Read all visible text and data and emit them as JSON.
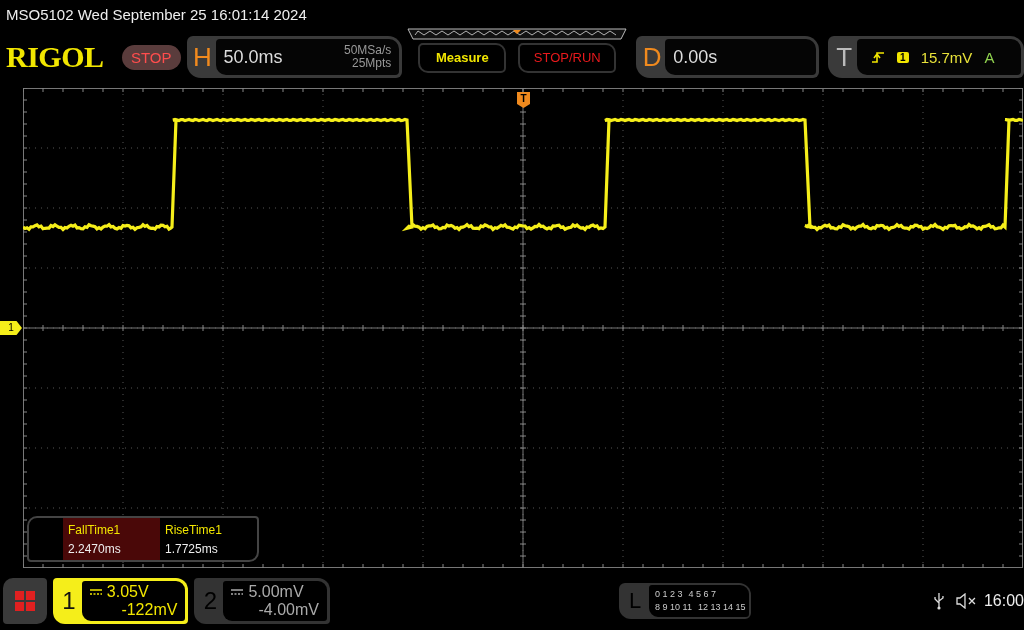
{
  "status_line": "MSO5102  Wed September 25 16:01:14 2024",
  "logo": "RIGOL",
  "run_state": "STOP",
  "horizontal": {
    "label": "H",
    "scale": "50.0ms",
    "sample_rate": "50MSa/s",
    "memory_depth": "25Mpts"
  },
  "buttons": [
    {
      "label": "Measure",
      "kind": "menu"
    },
    {
      "label": "STOP/RUN",
      "kind": "run"
    }
  ],
  "delay": {
    "label": "D",
    "value": "0.00s"
  },
  "trigger": {
    "label": "T",
    "source": "1",
    "level": "15.7mV",
    "mode": "A"
  },
  "trigger_marker": "T",
  "channel_marker": "1",
  "measurements": [
    {
      "name": "FallTime1",
      "value": "2.2470ms",
      "selected": true
    },
    {
      "name": "RiseTime1",
      "value": "1.7725ms",
      "selected": false
    }
  ],
  "channels": [
    {
      "number": "1",
      "scale": "3.05V",
      "offset": "-122mV",
      "selected": true
    },
    {
      "number": "2",
      "scale": "5.00mV",
      "offset": "-4.00mV",
      "selected": false
    }
  ],
  "logic": {
    "label": "L",
    "rows": [
      [
        "0 1 2 3",
        "4 5 6 7"
      ],
      [
        "8 9 10 11",
        "12 13 14 15"
      ]
    ]
  },
  "clock": "16:00"
}
